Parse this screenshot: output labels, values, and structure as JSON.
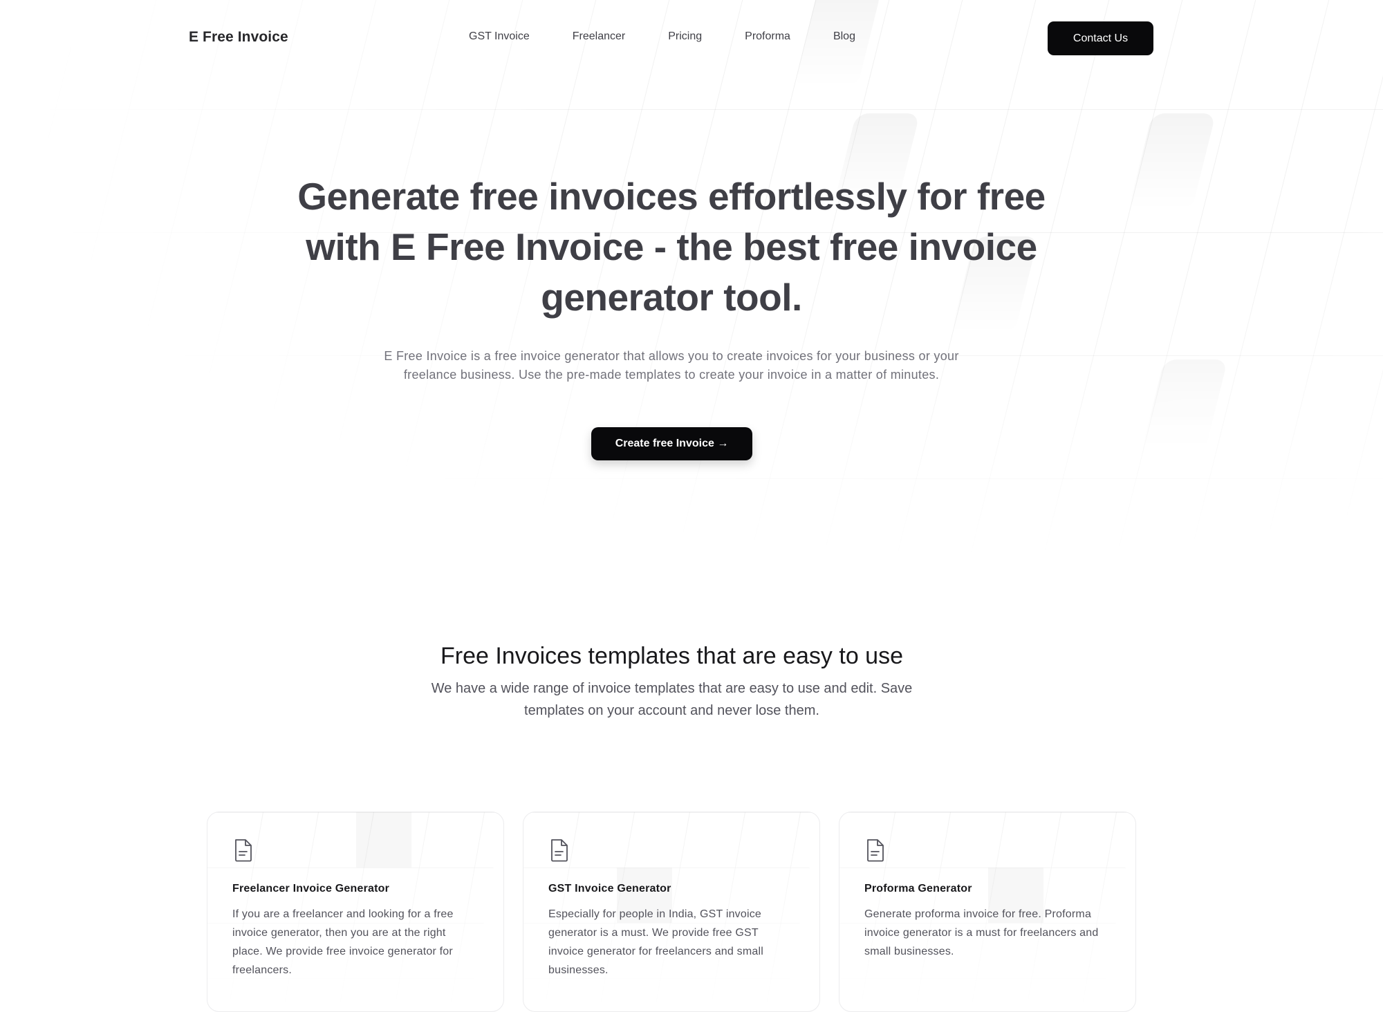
{
  "brand": {
    "name": "E Free Invoice"
  },
  "nav": {
    "links": [
      "GST Invoice",
      "Freelancer",
      "Pricing",
      "Proforma",
      "Blog"
    ],
    "contact_label": "Contact Us"
  },
  "hero": {
    "title": "Generate free invoices effortlessly for free with E Free Invoice - the best free invoice generator tool.",
    "subtitle": "E Free Invoice is a free invoice generator that allows you to create invoices for your business or your freelance business. Use the pre-made templates to create your invoice in a matter of minutes.",
    "cta_label": "Create free Invoice →"
  },
  "templates": {
    "title": "Free Invoices templates that are easy to use",
    "subtitle": "We have a wide range of invoice templates that are easy to use and edit. Save templates on your account and never lose them.",
    "cards": [
      {
        "icon": "document-icon",
        "title": "Freelancer Invoice Generator",
        "text": "If you are a freelancer and looking for a free invoice generator, then you are at the right place. We provide free invoice generator for freelancers."
      },
      {
        "icon": "document-icon",
        "title": "GST Invoice Generator",
        "text": "Especially for people in India, GST invoice generator is a must. We provide free GST invoice generator for freelancers and small businesses."
      },
      {
        "icon": "document-icon",
        "title": "Proforma Generator",
        "text": "Generate proforma invoice for free. Proforma invoice generator is a must for freelancers and small businesses."
      }
    ]
  },
  "colors": {
    "primary_button": "#09090b",
    "heading": "#3f3f46",
    "muted_text": "#71717a"
  }
}
